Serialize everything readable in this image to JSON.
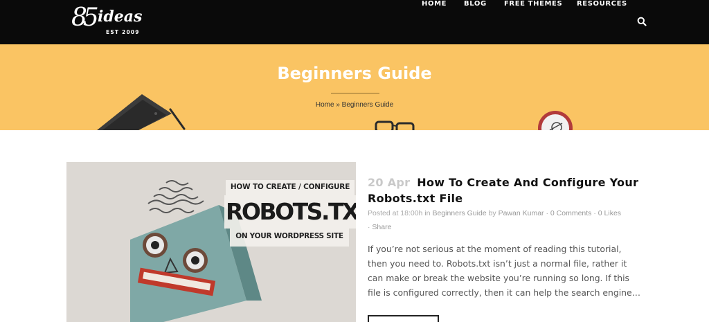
{
  "header": {
    "logo": {
      "number": "85",
      "word": "ideas",
      "est": "EST 2009"
    },
    "nav": [
      {
        "label": "HOME"
      },
      {
        "label": "BLOG"
      },
      {
        "label": "FREE THEMES"
      },
      {
        "label": "RESOURCES"
      }
    ],
    "search_icon": "search-icon"
  },
  "hero": {
    "title": "Beginners Guide",
    "breadcrumb": {
      "home": "Home",
      "separator": "»",
      "current": "Beginners Guide"
    }
  },
  "post": {
    "thumbnail": {
      "line1": "HOW TO CREATE / CONFIGURE",
      "line2": "ROBOTS.TXT",
      "line3": "ON YOUR WORDPRESS SITE"
    },
    "date": "20 Apr",
    "title": "How To Create And Configure Your Robots.txt File",
    "meta": {
      "posted_at": "Posted at 18:00h",
      "in": "in",
      "category": "Beginners Guide",
      "by": "by",
      "author": "Pawan Kumar",
      "comments": "0 Comments",
      "likes": "0",
      "likes_label": "Likes",
      "share": "Share"
    },
    "excerpt": "If you’re not serious at the moment of reading this tutorial, then you need to. Robots.txt isn’t just a normal file, rather it can make or break the website you’re running so long. If this file is configured correctly, then it can help the search engine…"
  },
  "colors": {
    "header_bg": "#0a0a0a",
    "hero_bg": "#fac463",
    "robot_teal": "#7fa8a6"
  }
}
